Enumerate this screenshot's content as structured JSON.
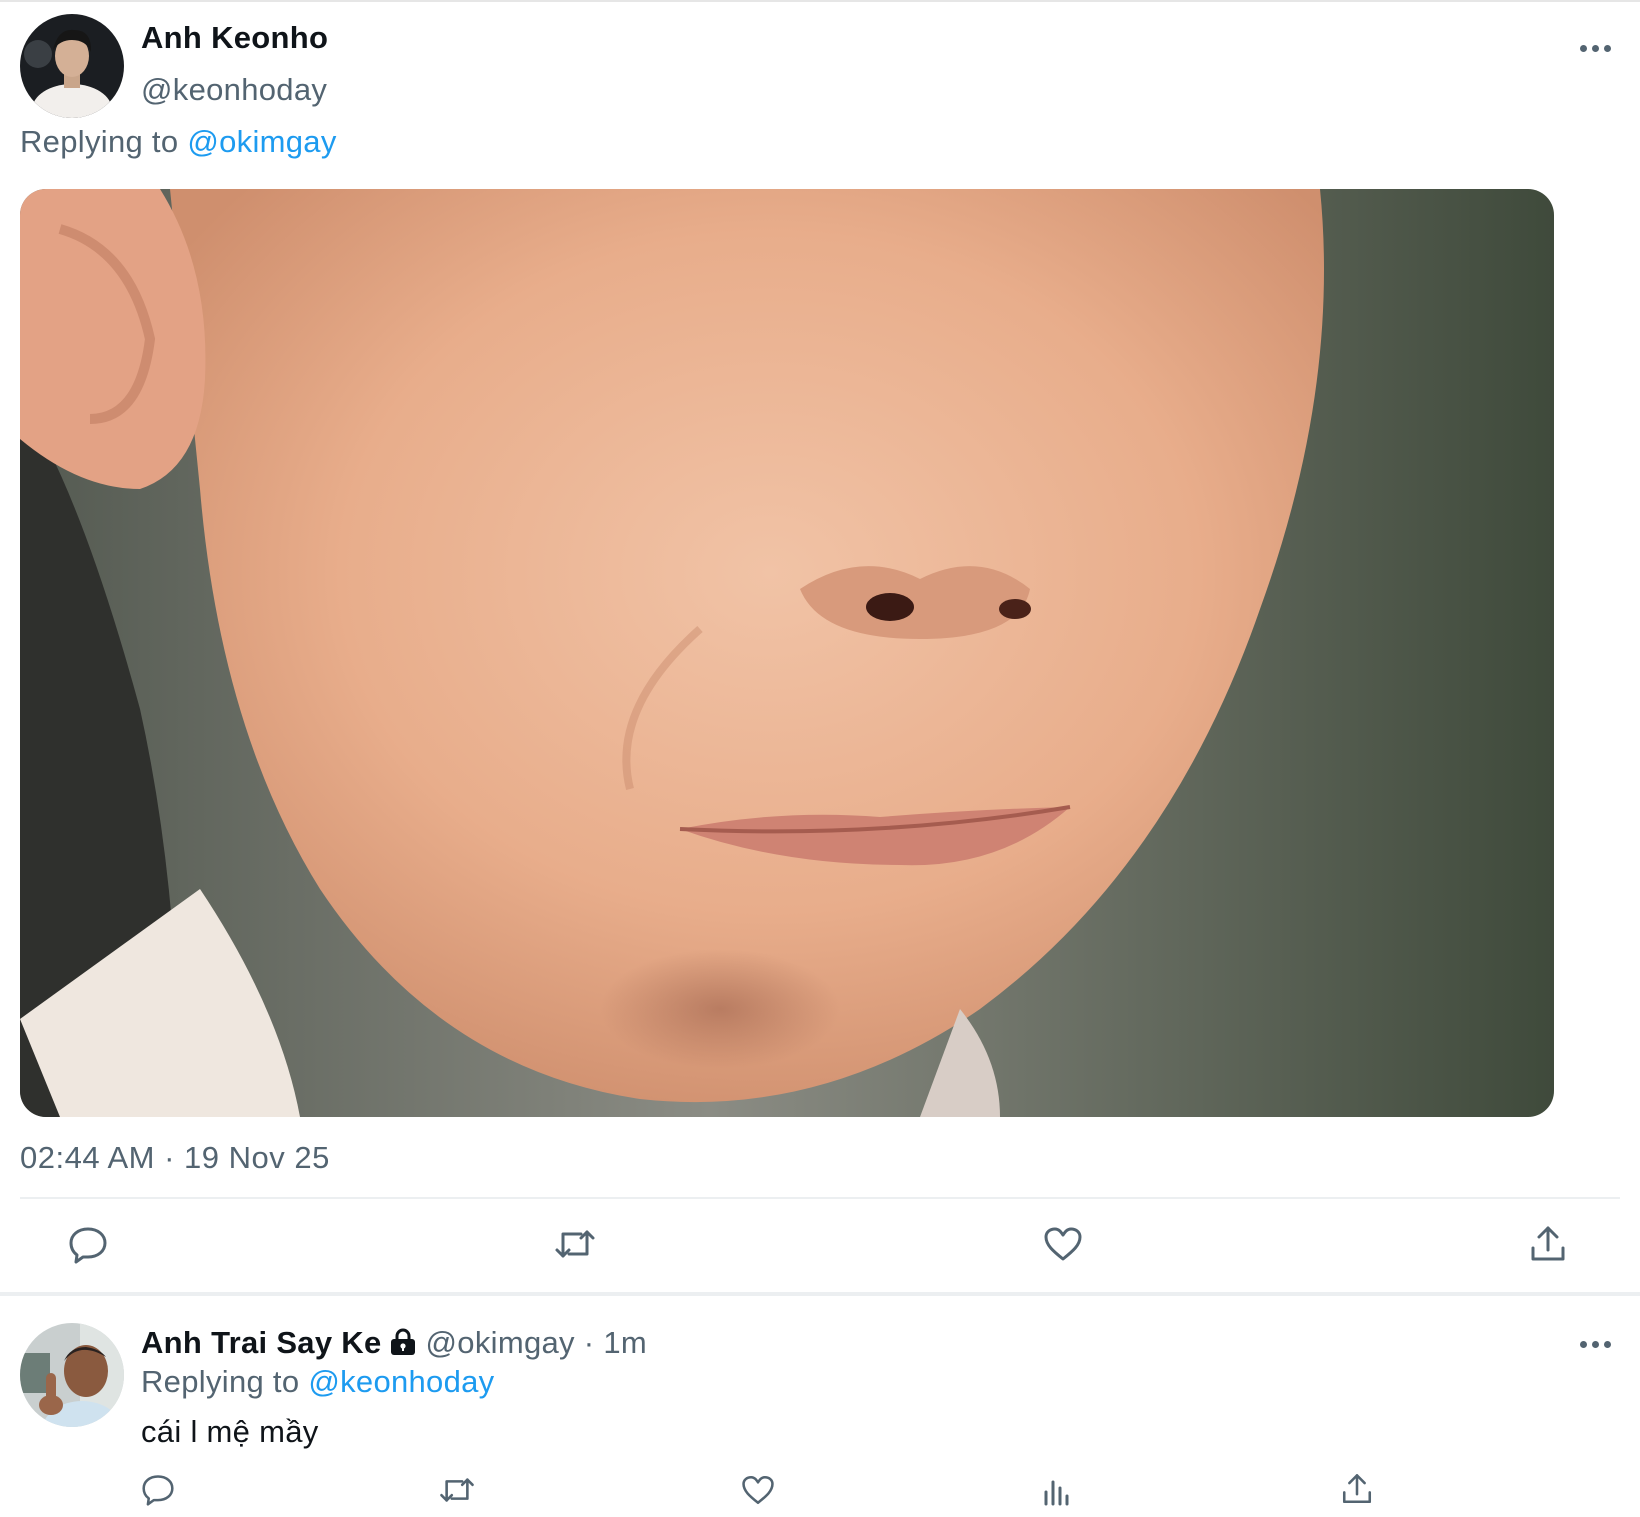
{
  "tweet": {
    "author_name": "Anh Keonho",
    "author_handle": "@keonhoday",
    "replying_prefix": "Replying to",
    "replying_to": "@okimgay",
    "timestamp": "02:44 AM · 19 Nov 25",
    "media_description": "close-up photo of smirking face",
    "actions": [
      "reply-icon",
      "retweet-icon",
      "like-icon",
      "share-icon"
    ]
  },
  "reply": {
    "author_name": "Anh Trai Say Ke",
    "author_handle": "@okimgay",
    "separator": "·",
    "time": "1m",
    "replying_prefix": "Replying to",
    "replying_to": "@keonhoday",
    "text": "cái l mệ mầy",
    "actions": [
      "reply-icon",
      "retweet-icon",
      "like-icon",
      "views-icon",
      "share-icon"
    ]
  },
  "colors": {
    "text": "#0f1419",
    "secondary": "#536471",
    "accent": "#1d9bf0",
    "divider": "#eceff1"
  }
}
